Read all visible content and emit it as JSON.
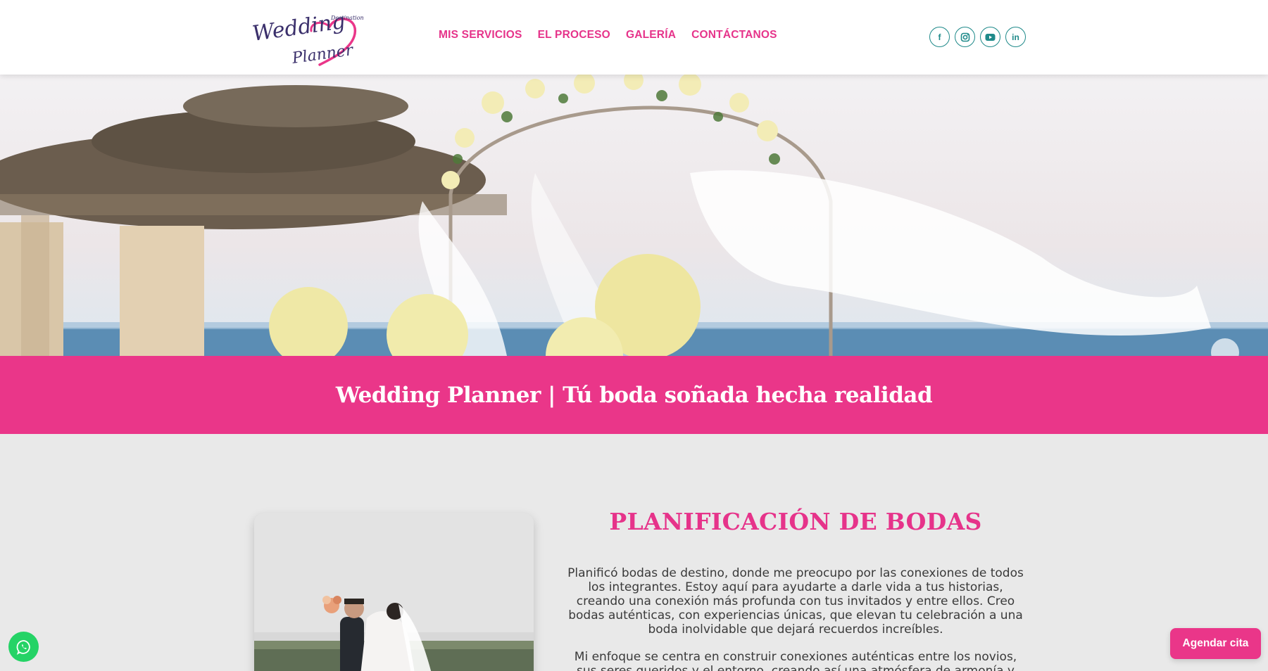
{
  "header": {
    "logo": {
      "script": "Wedding Planner",
      "small_text": "Destination"
    },
    "nav": [
      "MIS SERVICIOS",
      "EL PROCESO",
      "GALERÍA",
      "CONTÁCTANOS"
    ],
    "socials": [
      {
        "icon": "facebook-icon",
        "glyph": "f"
      },
      {
        "icon": "instagram-icon",
        "glyph": ""
      },
      {
        "icon": "youtube-icon",
        "glyph": ""
      },
      {
        "icon": "linkedin-icon",
        "glyph": "in"
      }
    ]
  },
  "banner": {
    "title": "Wedding Planner | Tú boda soñada hecha realidad"
  },
  "section": {
    "title": "PLANIFICACIÓN DE BODAS",
    "paragraph1": "Planificó bodas de destino, donde me preocupo por las conexiones de todos los integrantes. Estoy aquí para ayudarte a darle vida a tus historias, creando una conexión más profunda con tus invitados y entre ellos. Creo bodas auténticas, con experiencias únicas,  que elevan tu celebración a una boda inolvidable que dejará recuerdos increíbles.",
    "paragraph2": "Mi enfoque se centra en construir conexiones auténticas entre los novios, sus seres queridos y el entorno, creando así una atmósfera de armonía y"
  },
  "cta": {
    "label": "Agendar cita"
  },
  "colors": {
    "accent": "#ea3689",
    "teal": "#1f8a8a",
    "whatsapp": "#25d366"
  }
}
